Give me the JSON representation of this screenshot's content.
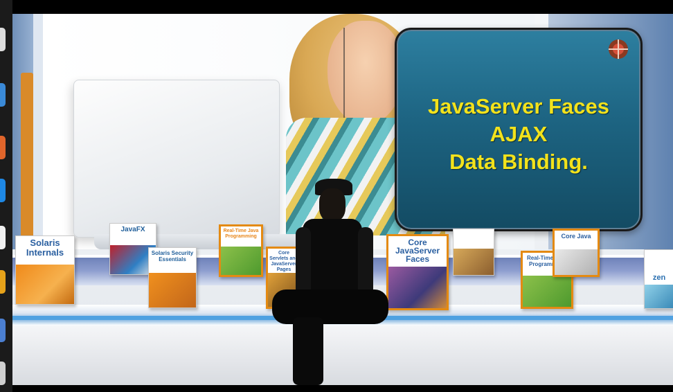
{
  "slide": {
    "lines": [
      "JavaServer Faces",
      "AJAX",
      "Data Binding."
    ],
    "logo_icon": "sl-logo-icon"
  },
  "books": [
    {
      "id": "b1",
      "title": "Solaris\nInternals"
    },
    {
      "id": "b2",
      "title": "JavaFX"
    },
    {
      "id": "b3",
      "title": "Solaris Security\nEssentials"
    },
    {
      "id": "b4",
      "title": "Real-Time Java\nProgramming"
    },
    {
      "id": "b5",
      "title": "Core Servlets and\nJavaServer Pages"
    },
    {
      "id": "b6",
      "title": "Core\nJavaServer\nFaces"
    },
    {
      "id": "b7",
      "title": "Real-Time Java\nProgramming"
    },
    {
      "id": "b8",
      "title": "Core Java"
    },
    {
      "id": "b9",
      "title": "zen"
    }
  ],
  "colors": {
    "slide_text": "#f2e21c",
    "slide_bg": "#1d6482",
    "shelf_blue": "#4fa1e1",
    "book_orange": "#e48a12"
  }
}
